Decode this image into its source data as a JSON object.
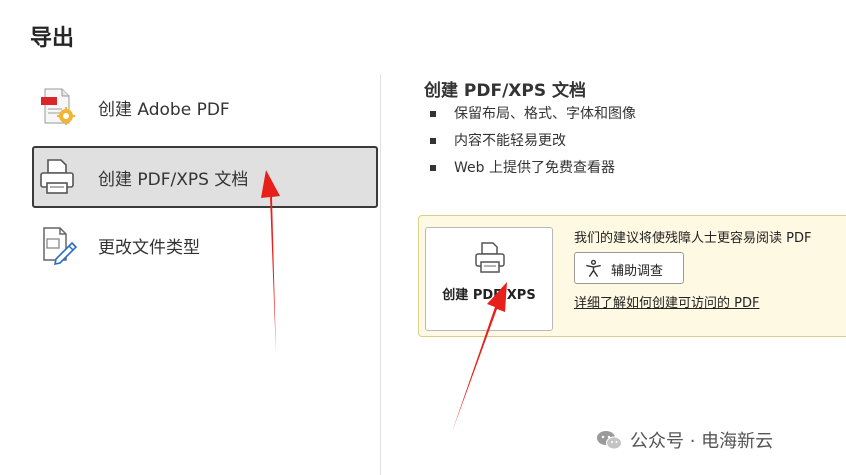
{
  "page": {
    "title": "导出"
  },
  "left_panel": {
    "items": [
      {
        "label": "创建 Adobe PDF",
        "icon": "adobe-pdf-icon",
        "selected": false
      },
      {
        "label": "创建 PDF/XPS 文档",
        "icon": "printer-icon",
        "selected": true
      },
      {
        "label": "更改文件类型",
        "icon": "change-file-type-icon",
        "selected": false
      }
    ]
  },
  "right_panel": {
    "title": "创建 PDF/XPS 文档",
    "bullets": [
      "保留布局、格式、字体和图像",
      "内容不能轻易更改",
      "Web 上提供了免费查看器"
    ],
    "create_button": {
      "label": "创建 PDF/XPS",
      "icon": "printer-icon"
    },
    "accessibility": {
      "text": "我们的建议将使残障人士更容易阅读 PDF",
      "button_label": "辅助调查",
      "button_icon": "accessibility-icon",
      "link_text": "详细了解如何创建可访问的 PDF"
    }
  },
  "watermark": {
    "text": "公众号 · 电海新云",
    "icon": "wechat-icon"
  },
  "colors": {
    "annotation_arrow": "#e8201b",
    "panel_bg": "#fdf9e3",
    "selected_bg": "#e0e0e0"
  }
}
